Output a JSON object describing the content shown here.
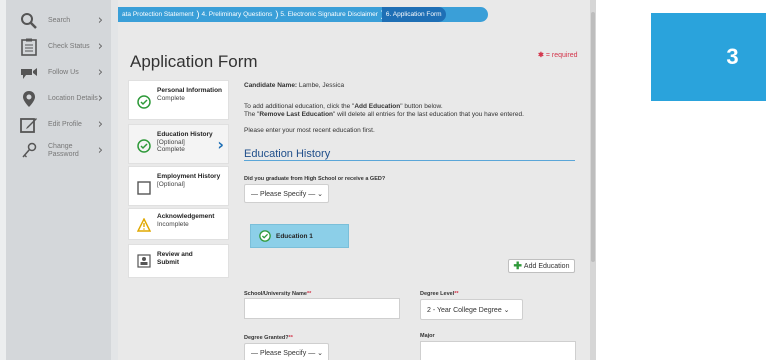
{
  "sidebar": {
    "items": [
      {
        "label": "Search",
        "icon": "search-icon"
      },
      {
        "label": "Check Status",
        "icon": "clipboard-icon"
      },
      {
        "label": "Follow Us",
        "icon": "megaphone-icon"
      },
      {
        "label": "Location Details",
        "icon": "map-pin-icon"
      },
      {
        "label": "Edit Profile",
        "icon": "edit-icon"
      },
      {
        "label": "Change Password",
        "icon": "key-icon"
      }
    ]
  },
  "tabs": [
    {
      "label": "ata Protection Statement"
    },
    {
      "label": "4. Preliminary Questions"
    },
    {
      "label": "5. Electronic Signature Disclaimer"
    },
    {
      "label": "6. Application Form"
    }
  ],
  "page": {
    "title": "Application Form",
    "required_note": "= required"
  },
  "steps": [
    {
      "title": "Personal Information",
      "status": "Complete",
      "state": "complete"
    },
    {
      "title": "Education History",
      "sub": "[Optional]",
      "status": "Complete",
      "state": "complete"
    },
    {
      "title": "Employment History",
      "sub": "[Optional]",
      "state": "unchecked"
    },
    {
      "title": "Acknowledgement",
      "status": "Incomplete",
      "state": "warning"
    },
    {
      "title": "Review and Submit",
      "state": "review"
    }
  ],
  "content": {
    "candidate_label": "Candidate Name:",
    "candidate_name": "Lambe, Jessica",
    "instruction1_pre": "To add additional education, click the \"",
    "instruction1_bold": "Add Education",
    "instruction1_post": "\" button below.",
    "instruction2_pre": "The \"",
    "instruction2_bold": "Remove Last Education",
    "instruction2_post": "\" will delete all entries for the last education that you have entered.",
    "instruction3": "Please enter your most recent education first.",
    "section_title": "Education History",
    "ged_question": "Did you graduate from High School or receive a GED?",
    "ged_select": "— Please Specify — ⌄",
    "education_card": "Education 1",
    "add_button": "Add Education",
    "school_label": "School/University Name",
    "degree_level_label": "Degree Level",
    "degree_level_value": "2 - Year College Degree ⌄",
    "degree_granted_label": "Degree Granted?",
    "degree_granted_value": "— Please Specify — ⌄",
    "major_label": "Major",
    "req_mark": "**"
  },
  "badge": {
    "number": "3"
  },
  "colors": {
    "accent": "#2aa3dc",
    "tab_active": "#1e6fb5",
    "complete": "#2f9a3a",
    "required": "#d3344a"
  }
}
